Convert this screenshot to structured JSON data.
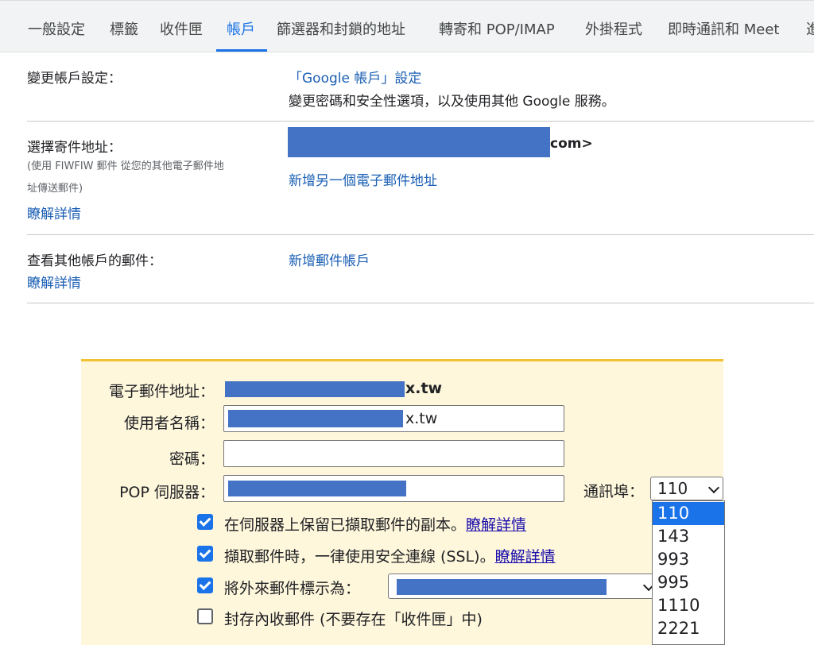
{
  "tabs": [
    {
      "label": "一般設定",
      "active": false
    },
    {
      "label": "標籤",
      "active": false
    },
    {
      "label": "收件匣",
      "active": false
    },
    {
      "label": "帳戶",
      "active": true
    },
    {
      "label": "篩選器和封鎖的地址",
      "active": false
    },
    {
      "label": "轉寄和 POP/IMAP",
      "active": false
    },
    {
      "label": "外掛程式",
      "active": false
    },
    {
      "label": "即時通訊和 Meet",
      "active": false
    },
    {
      "label": "進",
      "active": false
    }
  ],
  "account_settings": {
    "label": "變更帳戶設定：",
    "link": "「Google 帳戶」設定",
    "desc": "變更密碼和安全性選項，以及使用其他 Google 服務。"
  },
  "send_as": {
    "label": "選擇寄件地址：",
    "sub_line1": "(使用 FIWFIW 郵件 從您的其他電子郵件地",
    "sub_line2": "址傳送郵件)",
    "learn_more": "瞭解詳情",
    "address_tail": "com>",
    "add_link": "新增另一個電子郵件地址"
  },
  "check_mail": {
    "label": "查看其他帳戶的郵件：",
    "learn_more": "瞭解詳情",
    "add_link": "新增郵件帳戶"
  },
  "pop_dialog": {
    "email_label": "電子郵件地址：",
    "email_value_tail": "x.tw",
    "username_label": "使用者名稱：",
    "username_value_tail": "x.tw",
    "password_label": "密碼：",
    "server_label": "POP 伺服器：",
    "port_label": "通訊埠：",
    "port_value": "110",
    "port_options": [
      "110",
      "143",
      "993",
      "995",
      "1110",
      "2221"
    ],
    "options": [
      {
        "text": "在伺服器上保留已擷取郵件的副本。",
        "link": "瞭解詳情",
        "checked": true
      },
      {
        "text": "擷取郵件時，一律使用安全連線 (SSL)。",
        "link": "瞭解詳情",
        "checked": true
      },
      {
        "text": "將外來郵件標示為：",
        "link": "",
        "checked": true
      },
      {
        "text": "封存內收郵件 (不要存在「收件匣」中)",
        "link": "",
        "checked": false
      }
    ]
  },
  "colors": {
    "accent": "#1a73e8",
    "redaction": "#4472c4",
    "dialog_bg": "#fef7dc",
    "dialog_border": "#f1c232"
  }
}
